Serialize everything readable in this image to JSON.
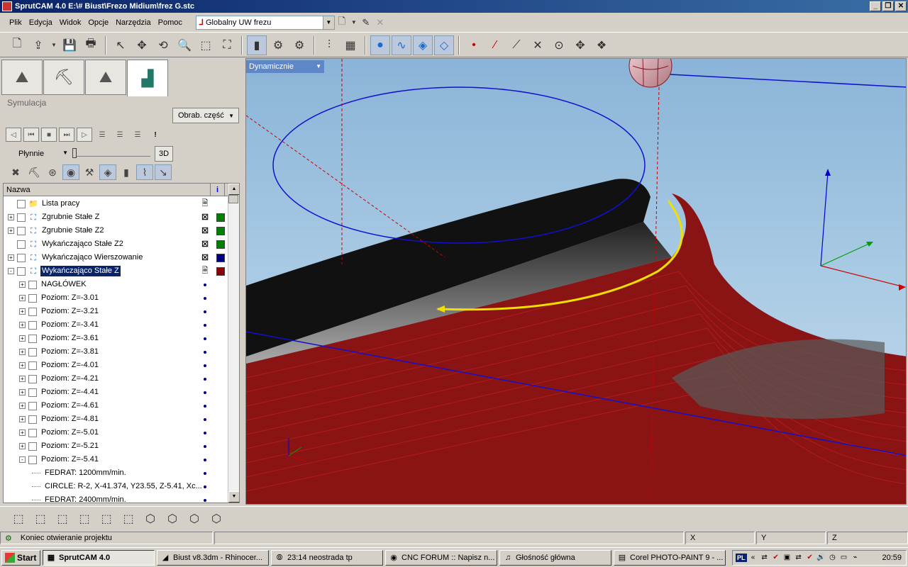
{
  "window": {
    "title": "SprutCAM 4.0 E:\\# Biust\\Frezo Midium\\frez G.stc",
    "buttons": [
      "_",
      "❐",
      "✕"
    ]
  },
  "menu": {
    "items": [
      "Plik",
      "Edycja",
      "Widok",
      "Opcje",
      "Narzędzia",
      "Pomoc"
    ],
    "coord_system": "Globalny UW frezu"
  },
  "left_panel": {
    "section_title": "Symulacja",
    "part_button": "Obrab. część",
    "speed_mode": "Płynnie",
    "view_3d": "3D"
  },
  "tree": {
    "header_name": "Nazwa",
    "rows": [
      {
        "label": "Lista pracy",
        "depth": 0,
        "expander": "",
        "icon": "folder",
        "status": "doc",
        "color": ""
      },
      {
        "label": "Zgrubnie Stałe Z",
        "depth": 0,
        "expander": "+",
        "icon": "op",
        "status": "x",
        "color": "#008000"
      },
      {
        "label": "Zgrubnie Stałe Z2",
        "depth": 0,
        "expander": "+",
        "icon": "op",
        "status": "x",
        "color": "#008000"
      },
      {
        "label": "Wykańczająco Stałe Z2",
        "depth": 0,
        "expander": "",
        "icon": "op",
        "status": "x",
        "color": "#008000"
      },
      {
        "label": "Wykańczająco Wierszowanie",
        "depth": 0,
        "expander": "+",
        "icon": "op",
        "status": "x",
        "color": "#000080"
      },
      {
        "label": "Wykańczająco Stałe Z",
        "depth": 0,
        "expander": "-",
        "icon": "op",
        "status": "doc",
        "color": "#8b0000",
        "selected": true
      },
      {
        "label": "NAGŁÓWEK",
        "depth": 1,
        "expander": "+",
        "icon": "",
        "status": "dot",
        "color": ""
      },
      {
        "label": "Poziom: Z=-3.01",
        "depth": 1,
        "expander": "+",
        "icon": "",
        "status": "dot",
        "color": ""
      },
      {
        "label": "Poziom: Z=-3.21",
        "depth": 1,
        "expander": "+",
        "icon": "",
        "status": "dot",
        "color": ""
      },
      {
        "label": "Poziom: Z=-3.41",
        "depth": 1,
        "expander": "+",
        "icon": "",
        "status": "dot",
        "color": ""
      },
      {
        "label": "Poziom: Z=-3.61",
        "depth": 1,
        "expander": "+",
        "icon": "",
        "status": "dot",
        "color": ""
      },
      {
        "label": "Poziom: Z=-3.81",
        "depth": 1,
        "expander": "+",
        "icon": "",
        "status": "dot",
        "color": ""
      },
      {
        "label": "Poziom: Z=-4.01",
        "depth": 1,
        "expander": "+",
        "icon": "",
        "status": "dot",
        "color": ""
      },
      {
        "label": "Poziom: Z=-4.21",
        "depth": 1,
        "expander": "+",
        "icon": "",
        "status": "dot",
        "color": ""
      },
      {
        "label": "Poziom: Z=-4.41",
        "depth": 1,
        "expander": "+",
        "icon": "",
        "status": "dot",
        "color": ""
      },
      {
        "label": "Poziom: Z=-4.61",
        "depth": 1,
        "expander": "+",
        "icon": "",
        "status": "dot",
        "color": ""
      },
      {
        "label": "Poziom: Z=-4.81",
        "depth": 1,
        "expander": "+",
        "icon": "",
        "status": "dot",
        "color": ""
      },
      {
        "label": "Poziom: Z=-5.01",
        "depth": 1,
        "expander": "+",
        "icon": "",
        "status": "dot",
        "color": ""
      },
      {
        "label": "Poziom: Z=-5.21",
        "depth": 1,
        "expander": "+",
        "icon": "",
        "status": "dot",
        "color": ""
      },
      {
        "label": "Poziom: Z=-5.41",
        "depth": 1,
        "expander": "-",
        "icon": "",
        "status": "dot",
        "color": ""
      },
      {
        "label": "FEDRAT: 1200mm/min.",
        "depth": 2,
        "expander": "",
        "icon": "",
        "status": "dot",
        "color": ""
      },
      {
        "label": "CIRCLE: R-2, X-41.374, Y23.55, Z-5.41, Xc...",
        "depth": 2,
        "expander": "",
        "icon": "",
        "status": "dot",
        "color": ""
      },
      {
        "label": "FEDRAT: 2400mm/min.",
        "depth": 2,
        "expander": "",
        "icon": "",
        "status": "dot",
        "color": ""
      }
    ]
  },
  "viewport": {
    "mode": "Dynamicznie",
    "colors": {
      "sky": "#8ab4d8",
      "toolpath": "#a00000",
      "circle": "#1010d0",
      "current_move": "#f0e000",
      "axis_x": "#d00000",
      "axis_y": "#00a000",
      "axis_z": "#0000d0"
    }
  },
  "status": {
    "message": "Koniec otwieranie projektu",
    "x_label": "X",
    "y_label": "Y",
    "z_label": "Z"
  },
  "taskbar": {
    "start": "Start",
    "tasks": [
      {
        "label": "SprutCAM 4.0",
        "icon": "app",
        "active": true
      },
      {
        "label": "Biust v8.3dm - Rhinocer...",
        "icon": "rhino",
        "active": false
      },
      {
        "label": "23:14 neostrada tp",
        "icon": "net",
        "active": false
      },
      {
        "label": "CNC FORUM :: Napisz n...",
        "icon": "firefox",
        "active": false
      },
      {
        "label": "Głośność główna",
        "icon": "volume",
        "active": false
      },
      {
        "label": "Corel PHOTO-PAINT 9 - ...",
        "icon": "corel",
        "active": false
      }
    ],
    "lang": "PL",
    "clock": "20:59"
  }
}
